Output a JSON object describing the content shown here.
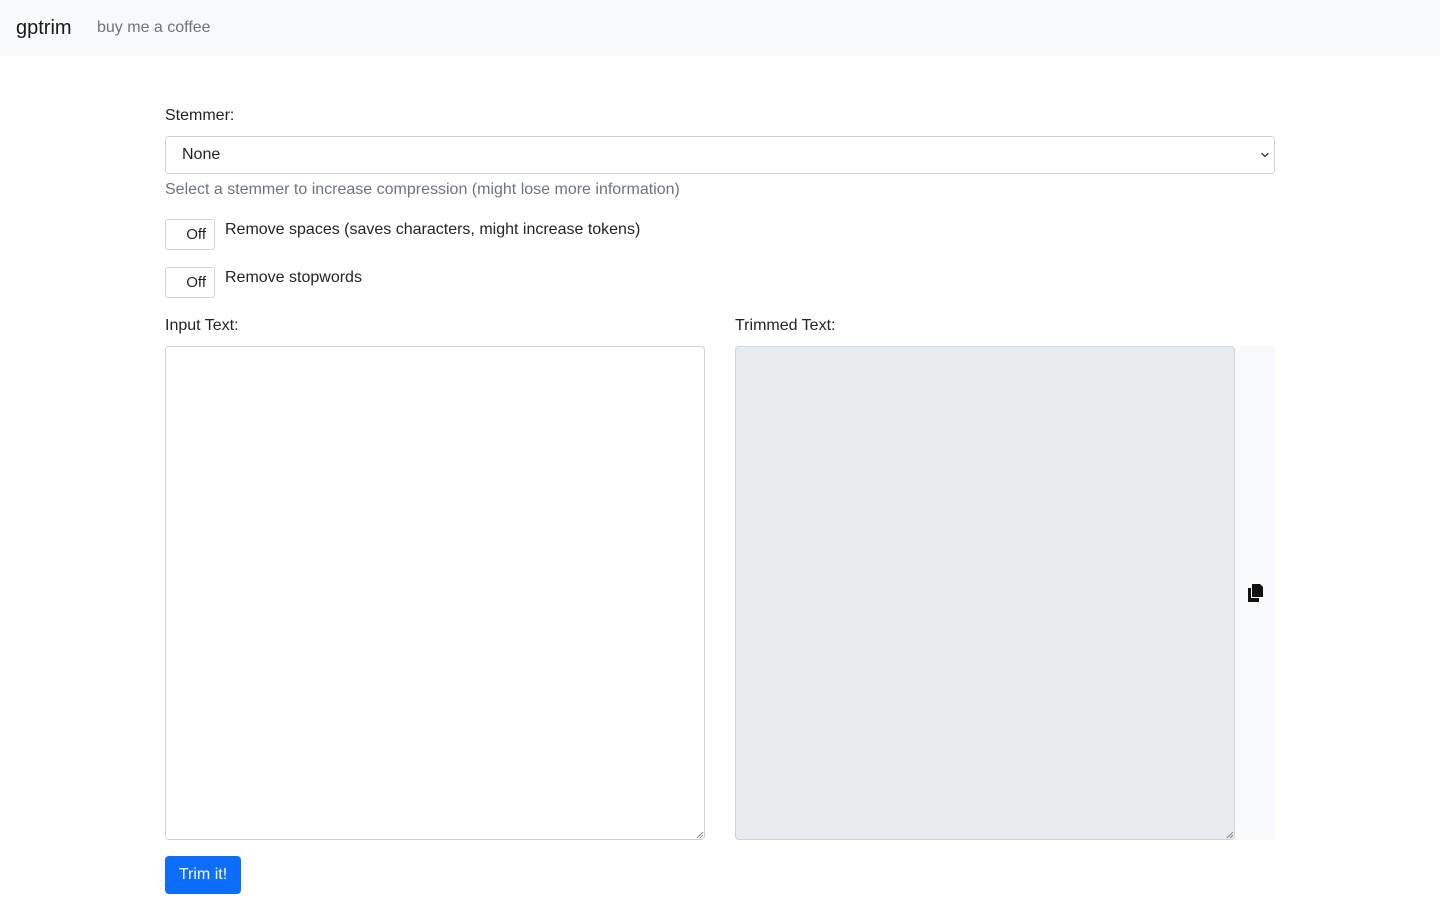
{
  "navbar": {
    "brand": "gptrim",
    "link": "buy me a coffee"
  },
  "stemmer": {
    "label": "Stemmer:",
    "selected": "None",
    "help": "Select a stemmer to increase compression (might lose more information)"
  },
  "toggles": [
    {
      "state": "Off",
      "label": "Remove spaces (saves characters, might increase tokens)"
    },
    {
      "state": "Off",
      "label": "Remove stopwords"
    }
  ],
  "input": {
    "label": "Input Text:",
    "value": ""
  },
  "output": {
    "label": "Trimmed Text:",
    "value": "",
    "copy_icon": "copy-icon"
  },
  "submit": {
    "label": "Trim it!"
  },
  "colors": {
    "navbar_bg": "#f8f9fa",
    "primary": "#0d6efd",
    "readonly_bg": "#e9ecef",
    "muted": "#6c757d"
  }
}
